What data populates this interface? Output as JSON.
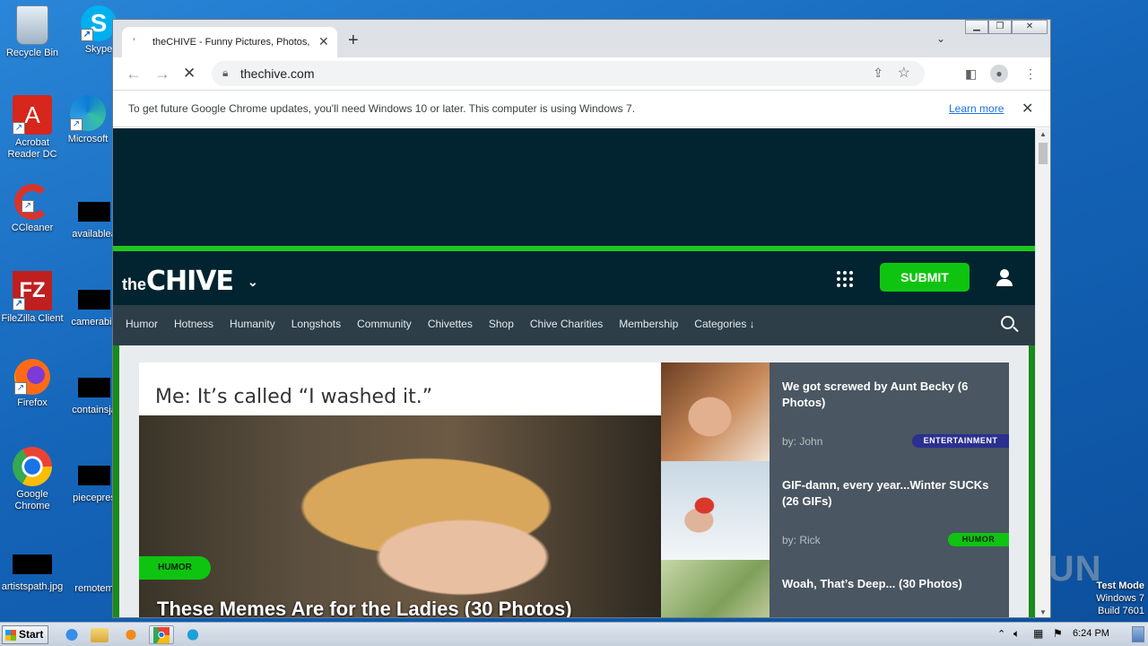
{
  "desktop": {
    "icons": [
      {
        "label": "Recycle Bin",
        "name": "recycle-bin-icon"
      },
      {
        "label": "Skype",
        "name": "skype-icon"
      },
      {
        "label": "Acrobat Reader DC",
        "name": "acrobat-icon"
      },
      {
        "label": "Microsoft",
        "name": "edge-icon"
      },
      {
        "label": "CCleaner",
        "name": "ccleaner-icon"
      },
      {
        "label": "availablea",
        "name": "file-icon"
      },
      {
        "label": "FileZilla Client",
        "name": "filezilla-icon"
      },
      {
        "label": "camerabin",
        "name": "file-icon"
      },
      {
        "label": "Firefox",
        "name": "firefox-icon"
      },
      {
        "label": "containsja",
        "name": "file-icon"
      },
      {
        "label": "Google Chrome",
        "name": "chrome-icon"
      },
      {
        "label": "piecepres",
        "name": "file-icon"
      },
      {
        "label": "artistspath.jpg",
        "name": "file-icon"
      },
      {
        "label": "remotem",
        "name": "file-icon"
      }
    ],
    "watermark": {
      "line1": "Test Mode",
      "line2": "Windows 7",
      "line3": "Build 7601"
    },
    "anyrun_text": "ANY RUN"
  },
  "taskbar": {
    "start_label": "Start",
    "clock": "6:24 PM"
  },
  "browser": {
    "tab_title": "theCHIVE - Funny Pictures, Photos,",
    "url": "thechive.com",
    "infobar_message": "To get future Google Chrome updates, you'll need Windows 10 or later. This computer is using Windows 7.",
    "infobar_link": "Learn more"
  },
  "site": {
    "logo_the": "the",
    "logo_chive": "CHIVE",
    "submit_label": "SUBMIT",
    "nav": [
      "Humor",
      "Hotness",
      "Humanity",
      "Longshots",
      "Community",
      "Chivettes",
      "Shop",
      "Chive Charities",
      "Membership",
      "Categories ↓"
    ],
    "hero": {
      "caption": "Me:  It’s called  “I washed it.”",
      "tag": "HUMOR",
      "headline": "These Memes Are for the Ladies (30 Photos)"
    },
    "cards": [
      {
        "title": "We got screwed by Aunt Becky (6 Photos)",
        "by": "by: John",
        "badge": "ENTERTAINMENT",
        "badge_color": "#2b2f8f"
      },
      {
        "title": "GIF-damn, every year...Winter SUCKs (26 GIFs)",
        "by": "by: Rick",
        "badge": "HUMOR",
        "badge_color": "#0fc410"
      },
      {
        "title": "Woah, That’s Deep... (30 Photos)",
        "by": "",
        "badge": "",
        "badge_color": ""
      }
    ],
    "colors": {
      "brand_green": "#0fc410",
      "header_bg": "#022430",
      "nav_bg": "#2d3e49"
    }
  }
}
